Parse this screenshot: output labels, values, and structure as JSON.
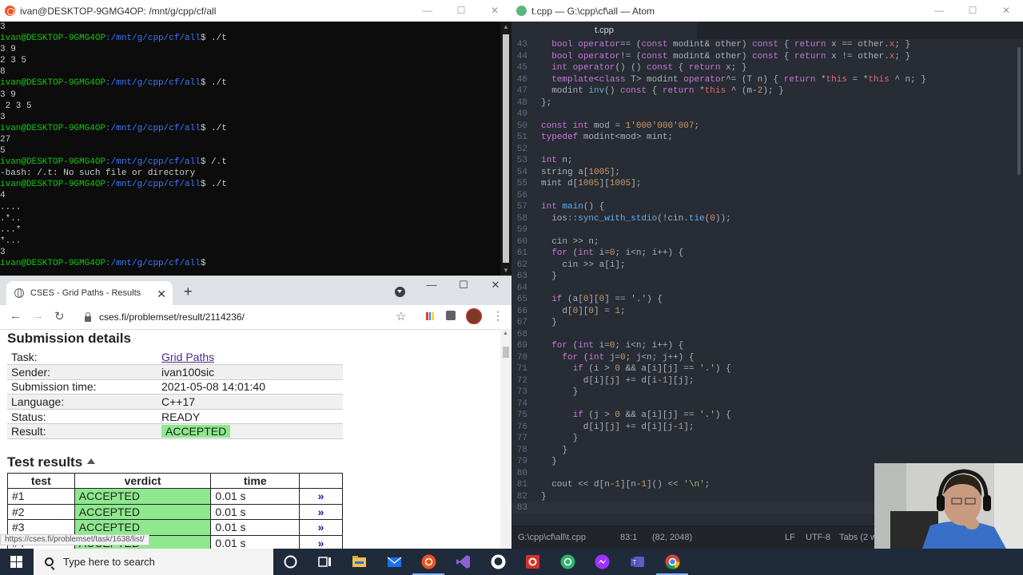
{
  "terminal": {
    "title": "ivan@DESKTOP-9GMG4OP: /mnt/g/cpp/cf/all",
    "prompt_user": "ivan@DESKTOP-9GMG4OP",
    "prompt_path": ":/mnt/g/cpp/cf/all",
    "lines": [
      {
        "kind": "out",
        "text": "3"
      },
      {
        "kind": "cmd",
        "text": "$ ./t"
      },
      {
        "kind": "out",
        "text": "3 9"
      },
      {
        "kind": "out",
        "text": "2 3 5"
      },
      {
        "kind": "out",
        "text": "8"
      },
      {
        "kind": "cmd",
        "text": "$ ./t"
      },
      {
        "kind": "out",
        "text": "3 9"
      },
      {
        "kind": "out",
        "text": " 2 3 5"
      },
      {
        "kind": "out",
        "text": "3"
      },
      {
        "kind": "cmd",
        "text": "$ ./t"
      },
      {
        "kind": "out",
        "text": "27"
      },
      {
        "kind": "out",
        "text": "5"
      },
      {
        "kind": "cmd",
        "text": "$ /.t"
      },
      {
        "kind": "out",
        "text": "-bash: /.t: No such file or directory"
      },
      {
        "kind": "cmd",
        "text": "$ ./t"
      },
      {
        "kind": "out",
        "text": "4"
      },
      {
        "kind": "out",
        "text": "...."
      },
      {
        "kind": "out",
        "text": ".*.."
      },
      {
        "kind": "out",
        "text": "...*"
      },
      {
        "kind": "out",
        "text": "*..."
      },
      {
        "kind": "out",
        "text": "3"
      },
      {
        "kind": "cmd",
        "text": "$ "
      }
    ]
  },
  "atom": {
    "title": "t.cpp — G:\\cpp\\cf\\all — Atom",
    "tab": "t.cpp",
    "status_path": "G:\\cpp\\cf\\all\\t.cpp",
    "status_cursor": "83:1",
    "status_selection": "(82, 2048)",
    "status_eol": "LF",
    "status_encoding": "UTF-8",
    "status_tabs": "Tabs (2 w",
    "code": [
      {
        "n": "43",
        "html": "  <span class='ty'>bool</span> <span class='kw'>operator</span>== (<span class='ty'>const</span> modint&amp; other) <span class='ty'>const</span> { <span class='kw'>return</span> x == other.<span class='mem'>x</span>; }"
      },
      {
        "n": "44",
        "html": "  <span class='ty'>bool</span> <span class='kw'>operator</span>!= (<span class='ty'>const</span> modint&amp; other) <span class='ty'>const</span> { <span class='kw'>return</span> x != other.<span class='mem'>x</span>; }"
      },
      {
        "n": "45",
        "html": "  <span class='ty'>int</span> <span class='kw'>operator</span>() () <span class='ty'>const</span> { <span class='kw'>return</span> x; }"
      },
      {
        "n": "46",
        "html": "  <span class='kw'>template</span>&lt;<span class='kw'>class</span> T&gt; modint <span class='kw'>operator</span>^= (T n) { <span class='kw'>return</span> *<span class='mem'>this</span> = *<span class='mem'>this</span> ^ n; }"
      },
      {
        "n": "47",
        "html": "  modint <span class='fn'>inv</span>() <span class='ty'>const</span> { <span class='kw'>return</span> *<span class='mem'>this</span> ^ (m-<span class='num'>2</span>); }"
      },
      {
        "n": "48",
        "html": "};"
      },
      {
        "n": "49",
        "html": ""
      },
      {
        "n": "50",
        "html": "<span class='ty'>const</span> <span class='ty'>int</span> mod = <span class='num'>1'000'000'007</span>;"
      },
      {
        "n": "51",
        "html": "<span class='kw'>typedef</span> modint&lt;mod&gt; mint;"
      },
      {
        "n": "52",
        "html": ""
      },
      {
        "n": "53",
        "html": "<span class='ty'>int</span> n;"
      },
      {
        "n": "54",
        "html": "string a[<span class='num'>1005</span>];"
      },
      {
        "n": "55",
        "html": "mint d[<span class='num'>1005</span>][<span class='num'>1005</span>];"
      },
      {
        "n": "56",
        "html": ""
      },
      {
        "n": "57",
        "html": "<span class='ty'>int</span> <span class='fn'>main</span>() {"
      },
      {
        "n": "58",
        "html": "  ios::<span class='fn'>sync_with_stdio</span>(!cin.<span class='fn'>tie</span>(<span class='num'>0</span>));"
      },
      {
        "n": "59",
        "html": ""
      },
      {
        "n": "60",
        "html": "  cin &gt;&gt; n;"
      },
      {
        "n": "61",
        "html": "  <span class='kw'>for</span> (<span class='ty'>int</span> i=<span class='num'>0</span>; i&lt;n; i++) {"
      },
      {
        "n": "62",
        "html": "    cin &gt;&gt; a[i];"
      },
      {
        "n": "63",
        "html": "  }"
      },
      {
        "n": "64",
        "html": ""
      },
      {
        "n": "65",
        "html": "  <span class='kw'>if</span> (a[<span class='num'>0</span>][<span class='num'>0</span>] == <span class='str'>'.'</span>) {"
      },
      {
        "n": "66",
        "html": "    d[<span class='num'>0</span>][<span class='num'>0</span>] = <span class='num'>1</span>;"
      },
      {
        "n": "67",
        "html": "  }"
      },
      {
        "n": "68",
        "html": ""
      },
      {
        "n": "69",
        "html": "  <span class='kw'>for</span> (<span class='ty'>int</span> i=<span class='num'>0</span>; i&lt;n; i++) {"
      },
      {
        "n": "70",
        "html": "    <span class='kw'>for</span> (<span class='ty'>int</span> j=<span class='num'>0</span>; j&lt;n; j++) {"
      },
      {
        "n": "71",
        "html": "      <span class='kw'>if</span> (i &gt; <span class='num'>0</span> &amp;&amp; a[i][j] == <span class='str'>'.'</span>) {"
      },
      {
        "n": "72",
        "html": "        d[i][j] += d[i-<span class='num'>1</span>][j];"
      },
      {
        "n": "73",
        "html": "      }"
      },
      {
        "n": "74",
        "html": ""
      },
      {
        "n": "75",
        "html": "      <span class='kw'>if</span> (j &gt; <span class='num'>0</span> &amp;&amp; a[i][j] == <span class='str'>'.'</span>) {"
      },
      {
        "n": "76",
        "html": "        d[i][j] += d[i][j-<span class='num'>1</span>];"
      },
      {
        "n": "77",
        "html": "      }"
      },
      {
        "n": "78",
        "html": "    }"
      },
      {
        "n": "79",
        "html": "  }"
      },
      {
        "n": "80",
        "html": ""
      },
      {
        "n": "81",
        "html": "  cout &lt;&lt; d[n-<span class='num'>1</span>][n-<span class='num'>1</span>]() &lt;&lt; <span class='str'>'\\n'</span>;"
      },
      {
        "n": "82",
        "html": "}"
      },
      {
        "n": "83",
        "html": ""
      }
    ]
  },
  "browser": {
    "tab_title": "CSES - Grid Paths - Results",
    "url": "cses.fi/problemset/result/2114236/",
    "hover_link": "https://cses.fi/problemset/task/1638/list/",
    "submission_title": "Submission details",
    "details": [
      {
        "label": "Task:",
        "value": "Grid Paths",
        "link": true
      },
      {
        "label": "Sender:",
        "value": "ivan100sic"
      },
      {
        "label": "Submission time:",
        "value": "2021-05-08 14:01:40"
      },
      {
        "label": "Language:",
        "value": "C++17"
      },
      {
        "label": "Status:",
        "value": "READY"
      },
      {
        "label": "Result:",
        "value": "ACCEPTED",
        "badge": true
      }
    ],
    "results_title": "Test results",
    "results_headers": [
      "test",
      "verdict",
      "time"
    ],
    "results": [
      {
        "test": "#1",
        "verdict": "ACCEPTED",
        "time": "0.01 s"
      },
      {
        "test": "#2",
        "verdict": "ACCEPTED",
        "time": "0.01 s"
      },
      {
        "test": "#3",
        "verdict": "ACCEPTED",
        "time": "0.01 s"
      },
      {
        "test": "#4",
        "verdict": "ACCEPTED",
        "time": "0.01 s"
      }
    ],
    "go_glyph": "»"
  },
  "taskbar": {
    "search_placeholder": "Type here to search"
  },
  "colors": {
    "accepted": "#8ee88e",
    "terminal_user": "#16c60c",
    "terminal_path": "#3b78ff"
  }
}
